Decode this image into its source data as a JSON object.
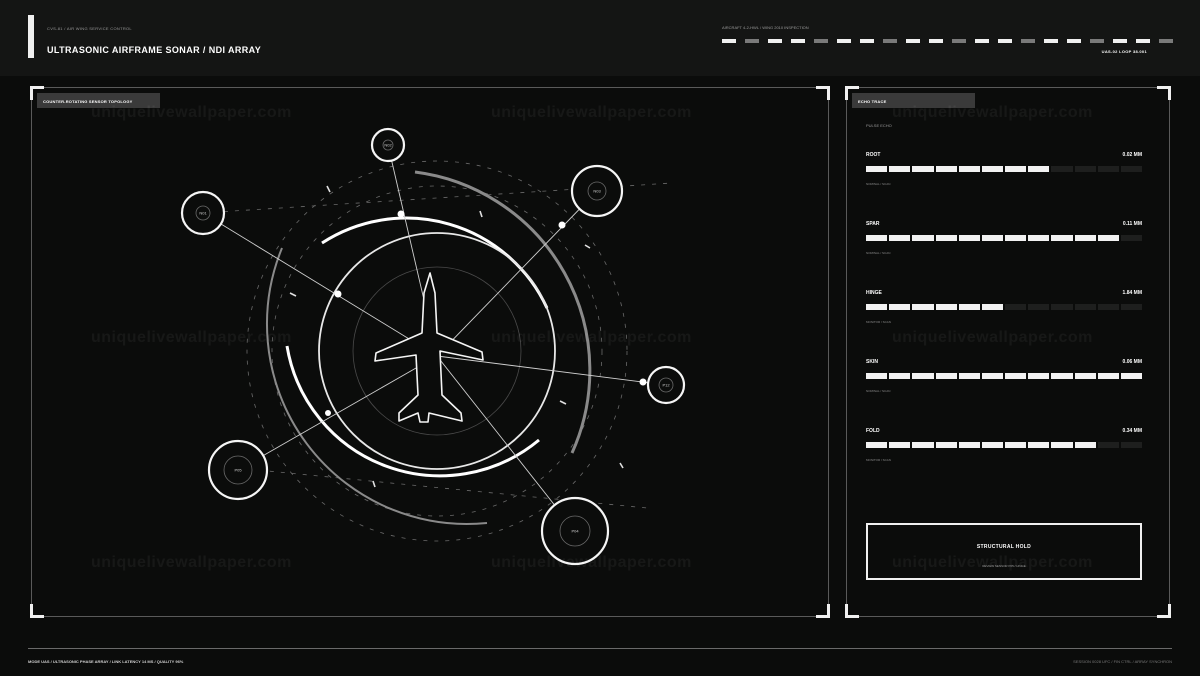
{
  "header": {
    "sub": "CVS-81 / AIR WING SERVICE CONTROL",
    "title": "ULTRASONIC AIRFRAME SONAR / NDI ARRAY",
    "right_label": "AIRCRAFT 4-2-HWL / WING 2010 INSPECTION",
    "status": "UAS-02  LOOP 38.001",
    "ticker": [
      true,
      false,
      true,
      true,
      false,
      true,
      true,
      false,
      true,
      true,
      false,
      true,
      true,
      false,
      true,
      true,
      false,
      true,
      true,
      false
    ]
  },
  "left_panel": {
    "tag": "COUNTER-ROTATING SENSOR TOPOLOGY",
    "nodes": [
      {
        "label": "N01"
      },
      {
        "label": "N02"
      },
      {
        "label": "N03"
      },
      {
        "label": "P12"
      },
      {
        "label": "P04"
      },
      {
        "label": "P05"
      }
    ]
  },
  "right_panel": {
    "tag": "ECHO TRACE",
    "sub": "PULSE ECHO",
    "metrics": [
      {
        "name": "ROOT",
        "value": "0.02 MM",
        "fill": 0.7,
        "note": "NOMINAL / SCAN"
      },
      {
        "name": "SPAR",
        "value": "0.11 MM",
        "fill": 0.9,
        "note": "NOMINAL / SCAN"
      },
      {
        "name": "HINGE",
        "value": "1.84 MM",
        "fill": 0.5,
        "note": "MONITOR / SCAN"
      },
      {
        "name": "SKIN",
        "value": "0.06 MM",
        "fill": 1.0,
        "note": "NOMINAL / SCAN"
      },
      {
        "name": "FOLD",
        "value": "0.34 MM",
        "fill": 0.8,
        "note": "MONITOR / SCAN"
      }
    ],
    "hold_title": "STRUCTURAL HOLD",
    "hold_sub": "REVIEW SENSOR P05 / HINGE"
  },
  "footer": {
    "left": "MODE UAS / ULTRASONIC PHASE ARRAY / LINK LATENCY 14 MS / QUALITY 96%",
    "right": "SESSION 0028 UFC / FIN CTRL / ARRAY SYNCHRON"
  },
  "watermark": "uniquelivewallpaper.com",
  "colors": {
    "background": "#0b0c0b",
    "header": "#141514",
    "accent": "#f0f0f0",
    "panel_border": "#5a5a5a"
  }
}
